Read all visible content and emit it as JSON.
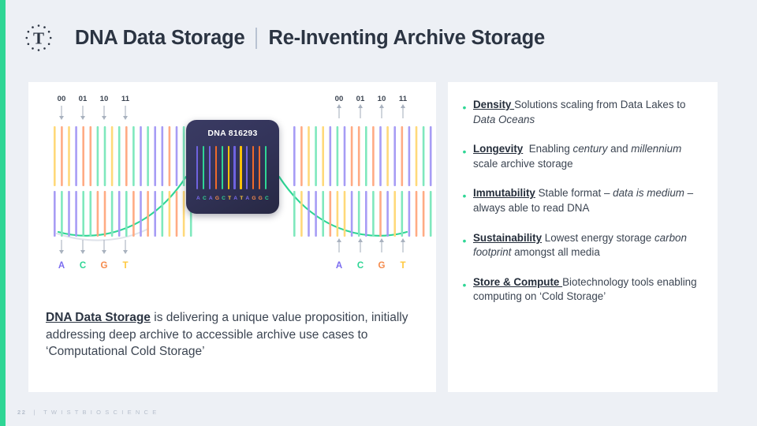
{
  "theme": {
    "background": "#edf0f5",
    "accent_bar_color": "#2fd695",
    "panel_background": "#ffffff",
    "title_color": "#2b3442",
    "bullet_dot_color": "#2fd695",
    "card_background": "#33345a"
  },
  "header": {
    "logo_letter": "T",
    "logo_name": "twist-bioscience-logo",
    "title_main": "DNA Data Storage",
    "title_sub": "Re-Inventing Archive Storage"
  },
  "diagram": {
    "binary_labels": [
      "00",
      "01",
      "10",
      "11"
    ],
    "nucleotide_labels": [
      "A",
      "C",
      "G",
      "T"
    ],
    "nucleotide_colors": {
      "A": "#7b6cf0",
      "C": "#2fd695",
      "G": "#f58a4b",
      "T": "#ffc83d"
    },
    "bar_palette": [
      "#ffd97a",
      "#a79cf5",
      "#ffab84",
      "#7fe8bd"
    ],
    "curve_color": "#2fd695",
    "left_bars_top": [
      "#ffd97a",
      "#ffab84",
      "#ffd97a",
      "#a79cf5",
      "#ffab84",
      "#ffab84",
      "#7fe8bd",
      "#7fe8bd",
      "#ffd97a",
      "#7fe8bd",
      "#ffab84",
      "#7fe8bd",
      "#a79cf5",
      "#7fe8bd",
      "#a79cf5",
      "#a79cf5",
      "#ffab84",
      "#a79cf5",
      "#7fe8bd",
      "#a79cf5"
    ],
    "left_bars_bottom": [
      "#a79cf5",
      "#7fe8bd",
      "#a79cf5",
      "#a79cf5",
      "#7fe8bd",
      "#7fe8bd",
      "#ffab84",
      "#ffab84",
      "#7fe8bd",
      "#a79cf5",
      "#7fe8bd",
      "#ffab84",
      "#a79cf5",
      "#ffab84",
      "#a79cf5",
      "#7fe8bd",
      "#ffd97a",
      "#ffab84",
      "#ffd97a",
      "#7fe8bd"
    ],
    "right_bars_top": [
      "#a79cf5",
      "#ffab84",
      "#ffd97a",
      "#7fe8bd",
      "#ffd97a",
      "#a79cf5",
      "#7fe8bd",
      "#a79cf5",
      "#ffab84",
      "#ffab84",
      "#7fe8bd",
      "#ffab84",
      "#a79cf5",
      "#ffd97a",
      "#a79cf5",
      "#ffab84",
      "#a79cf5",
      "#ffd97a",
      "#7fe8bd",
      "#a79cf5"
    ],
    "right_bars_bottom": [
      "#7fe8bd",
      "#ffd97a",
      "#a79cf5",
      "#a79cf5",
      "#7fe8bd",
      "#ffab84",
      "#ffd97a",
      "#ffd97a",
      "#a79cf5",
      "#7fe8bd",
      "#a79cf5",
      "#7fe8bd",
      "#ffab84",
      "#a79cf5",
      "#ffd97a",
      "#7fe8bd",
      "#a79cf5",
      "#ffab84",
      "#ffab84",
      "#7fe8bd"
    ]
  },
  "dna_card": {
    "title": "DNA 816293",
    "sequence": [
      "A",
      "C",
      "A",
      "G",
      "C",
      "T",
      "A",
      "T",
      "A",
      "G",
      "G",
      "C"
    ],
    "bar_colors": [
      "#6f63e0",
      "#2fd695",
      "#6f63e0",
      "#f06a2a",
      "#2fd695",
      "#ffc107",
      "#6f63e0",
      "#ffc107",
      "#6f63e0",
      "#f06a2a",
      "#f06a2a",
      "#2fd695"
    ]
  },
  "left_body": {
    "lead": "DNA Data Storage",
    "rest": " is delivering a unique value proposition, initially addressing deep archive to accessible archive use cases to ‘Computational Cold Storage’"
  },
  "bullets": [
    {
      "marker": "•",
      "term": "Density",
      "html": "<b>Density </b>Solutions scaling from Data Lakes to <i>Data Oceans</i>"
    },
    {
      "marker": "•",
      "term": "Longevity",
      "html": "<b>Longevity</b>&nbsp; Enabling <i>century</i> and <i>millennium</i> scale archive storage"
    },
    {
      "marker": "•",
      "term": "Immutability",
      "html": "<b>Immutability</b> Stable format – <i>data is medium</i> – always able to read DNA"
    },
    {
      "marker": "•",
      "term": "Sustainability",
      "html": "<b>Sustainability</b> Lowest energy storage <i>carbon footprint</i> amongst all media"
    },
    {
      "marker": "•",
      "term": "Store & Compute",
      "html": "<b>Store &amp; Compute </b>Biotechnology tools enabling computing on ‘Cold Storage’"
    }
  ],
  "footer": {
    "page_number": "22",
    "separator": "|",
    "company": "T W I S T   B I O S C I E N C E"
  }
}
